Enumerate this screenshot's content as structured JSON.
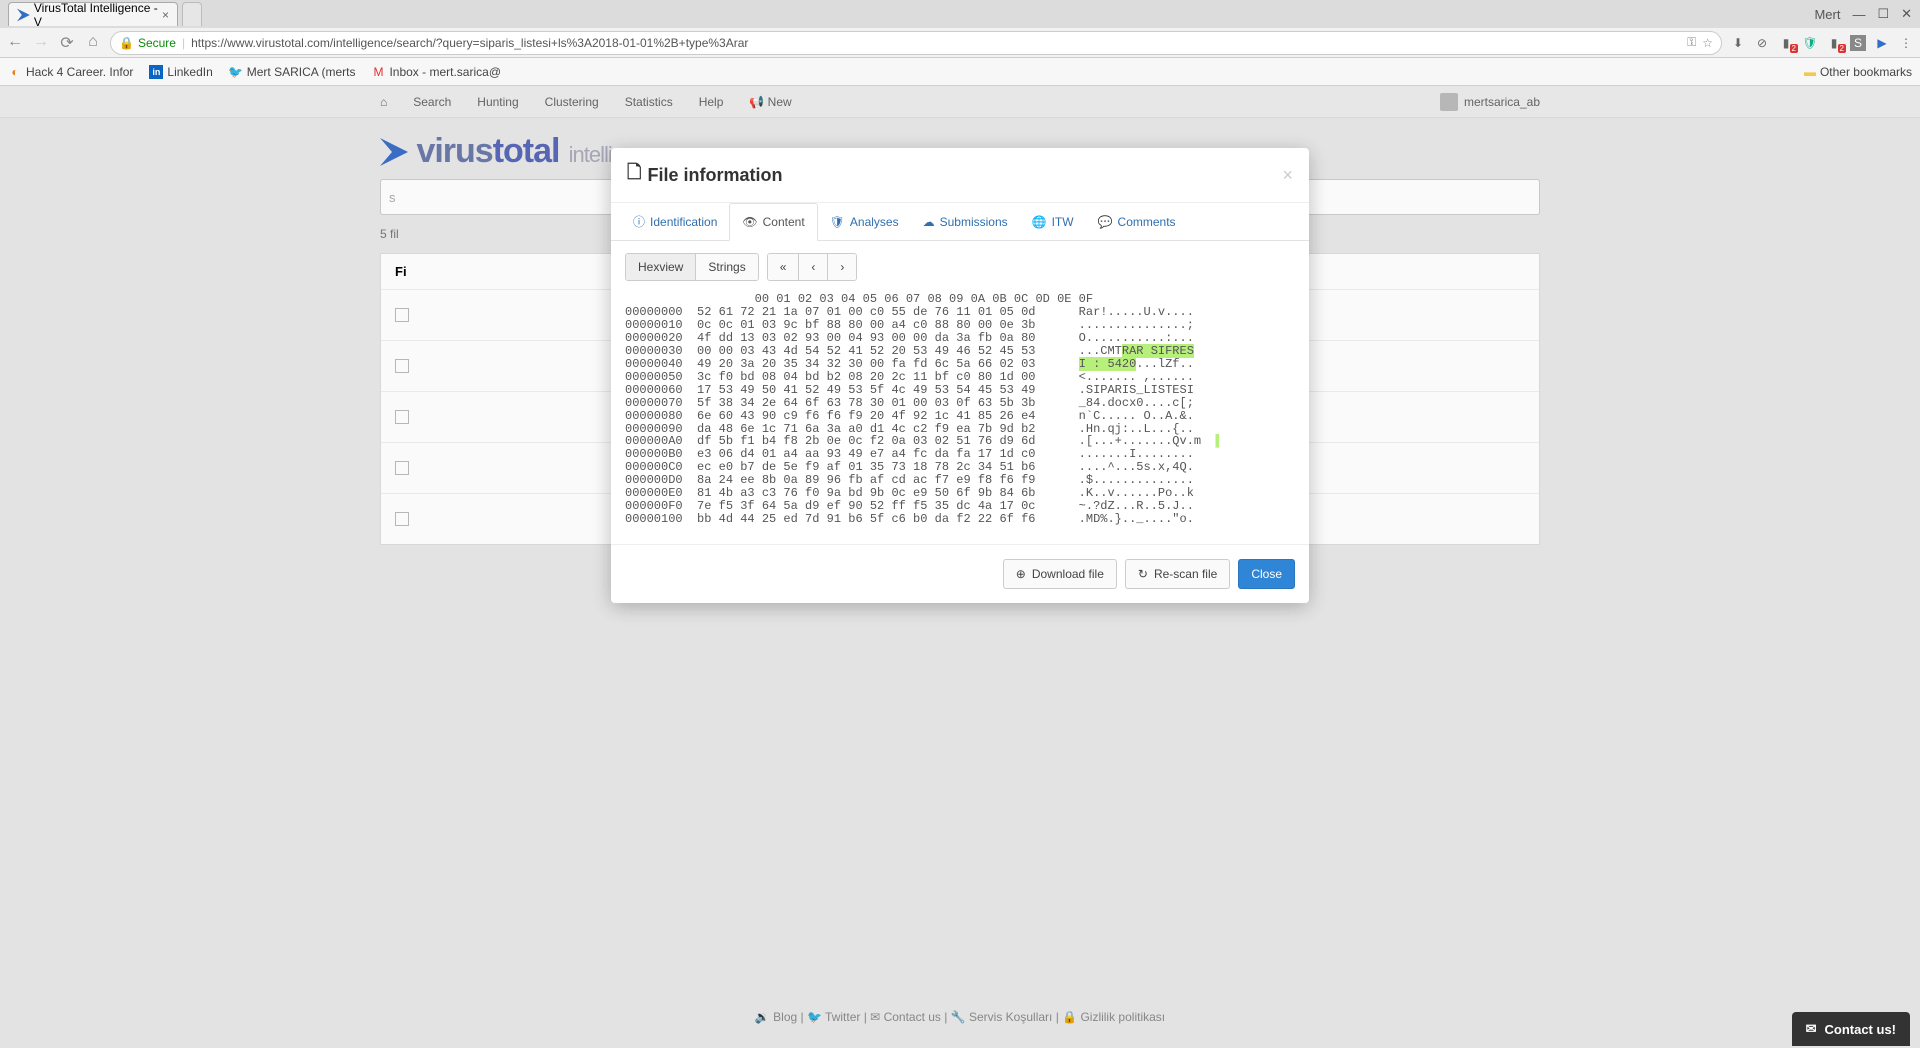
{
  "browser": {
    "tab_title": "VirusTotal Intelligence - V",
    "user_label": "Mert",
    "url_secure": "Secure",
    "url": "https://www.virustotal.com/intelligence/search/?query=siparis_listesi+ls%3A2018-01-01%2B+type%3Arar",
    "bookmarks": [
      {
        "label": "Hack 4 Career. Infor"
      },
      {
        "label": "LinkedIn"
      },
      {
        "label": "Mert SARICA (merts"
      },
      {
        "label": "Inbox - mert.sarica@"
      }
    ],
    "other_bookmarks": "Other bookmarks"
  },
  "nav": {
    "items": [
      "Search",
      "Hunting",
      "Clustering",
      "Statistics",
      "Help",
      "New"
    ],
    "username": "mertsarica_ab"
  },
  "page": {
    "search_placeholder": "s",
    "result_line": "5 fil",
    "file_header": "Fi"
  },
  "modal": {
    "title": "File information",
    "tabs": [
      {
        "label": "Identification"
      },
      {
        "label": "Content"
      },
      {
        "label": "Analyses"
      },
      {
        "label": "Submissions"
      },
      {
        "label": "ITW"
      },
      {
        "label": "Comments"
      }
    ],
    "toggles": [
      "Hexview",
      "Strings"
    ],
    "download_label": "Download file",
    "rescan_label": "Re-scan file",
    "close_label": "Close"
  },
  "hex": {
    "header": "          00 01 02 03 04 05 06 07 08 09 0A 0B 0C 0D 0E 0F",
    "rows": [
      {
        "addr": "00000000",
        "b": "52 61 72 21 1a 07 01 00 c0 55 de 76 11 01 05 0d",
        "a": "Rar!.....U.v...."
      },
      {
        "addr": "00000010",
        "b": "0c 0c 01 03 9c bf 88 80 00 a4 c0 88 80 00 0e 3b",
        "a": "...............;"
      },
      {
        "addr": "00000020",
        "b": "4f dd 13 03 02 93 00 04 93 00 00 da 3a fb 0a 80",
        "a": "O...........:..."
      },
      {
        "addr": "00000030",
        "b": "00 00 03 43 4d 54 52 41 52 20 53 49 46 52 45 53",
        "a": "...CMT",
        "hl": "RAR SIFRES"
      },
      {
        "addr": "00000040",
        "b": "49 20 3a 20 35 34 32 30 00 fa fd 6c 5a 66 02 03",
        "hl2": "I : 5420",
        "a": "...lZf.."
      },
      {
        "addr": "00000050",
        "b": "3c f0 bd 08 04 bd b2 08 20 2c 11 bf c0 80 1d 00",
        "a": "<....... ,......"
      },
      {
        "addr": "00000060",
        "b": "17 53 49 50 41 52 49 53 5f 4c 49 53 54 45 53 49",
        "a": ".SIPARIS_LISTESI"
      },
      {
        "addr": "00000070",
        "b": "5f 38 34 2e 64 6f 63 78 30 01 00 03 0f 63 5b 3b",
        "a": "_84.docx0....c[;"
      },
      {
        "addr": "00000080",
        "b": "6e 60 43 90 c9 f6 f6 f9 20 4f 92 1c 41 85 26 e4",
        "a": "n`C..... O..A.&."
      },
      {
        "addr": "00000090",
        "b": "da 48 6e 1c 71 6a 3a a0 d1 4c c2 f9 ea 7b 9d b2",
        "a": ".Hn.qj:..L...{.."
      },
      {
        "addr": "000000A0",
        "b": "df 5b f1 b4 f8 2b 0e 0c f2 0a 03 02 51 76 d9 6d",
        "a": ".[...+.......Qv.m"
      },
      {
        "addr": "000000B0",
        "b": "e3 06 d4 01 a4 aa 93 49 e7 a4 fc da fa 17 1d c0",
        "a": ".......I........"
      },
      {
        "addr": "000000C0",
        "b": "ec e0 b7 de 5e f9 af 01 35 73 18 78 2c 34 51 b6",
        "a": "....^...5s.x,4Q."
      },
      {
        "addr": "000000D0",
        "b": "8a 24 ee 8b 0a 89 96 fb af cd ac f7 e9 f8 f6 f9",
        "a": ".$.............."
      },
      {
        "addr": "000000E0",
        "b": "81 4b a3 c3 76 f0 9a bd 9b 0c e9 50 6f 9b 84 6b",
        "a": ".K..v......Po..k"
      },
      {
        "addr": "000000F0",
        "b": "7e f5 3f 64 5a d9 ef 90 52 ff f5 35 dc 4a 17 0c",
        "a": "~.?dZ...R..5.J.."
      },
      {
        "addr": "00000100",
        "b": "bb 4d 44 25 ed 7d 91 b6 5f c6 b0 da f2 22 6f f6",
        "a": ".MD%.}.._....\"o."
      }
    ]
  },
  "footer": {
    "links": [
      "Blog",
      "Twitter",
      "Contact us",
      "Servis Koşulları",
      "Gizlilik politikası"
    ]
  },
  "contact_widget": "Contact us!"
}
